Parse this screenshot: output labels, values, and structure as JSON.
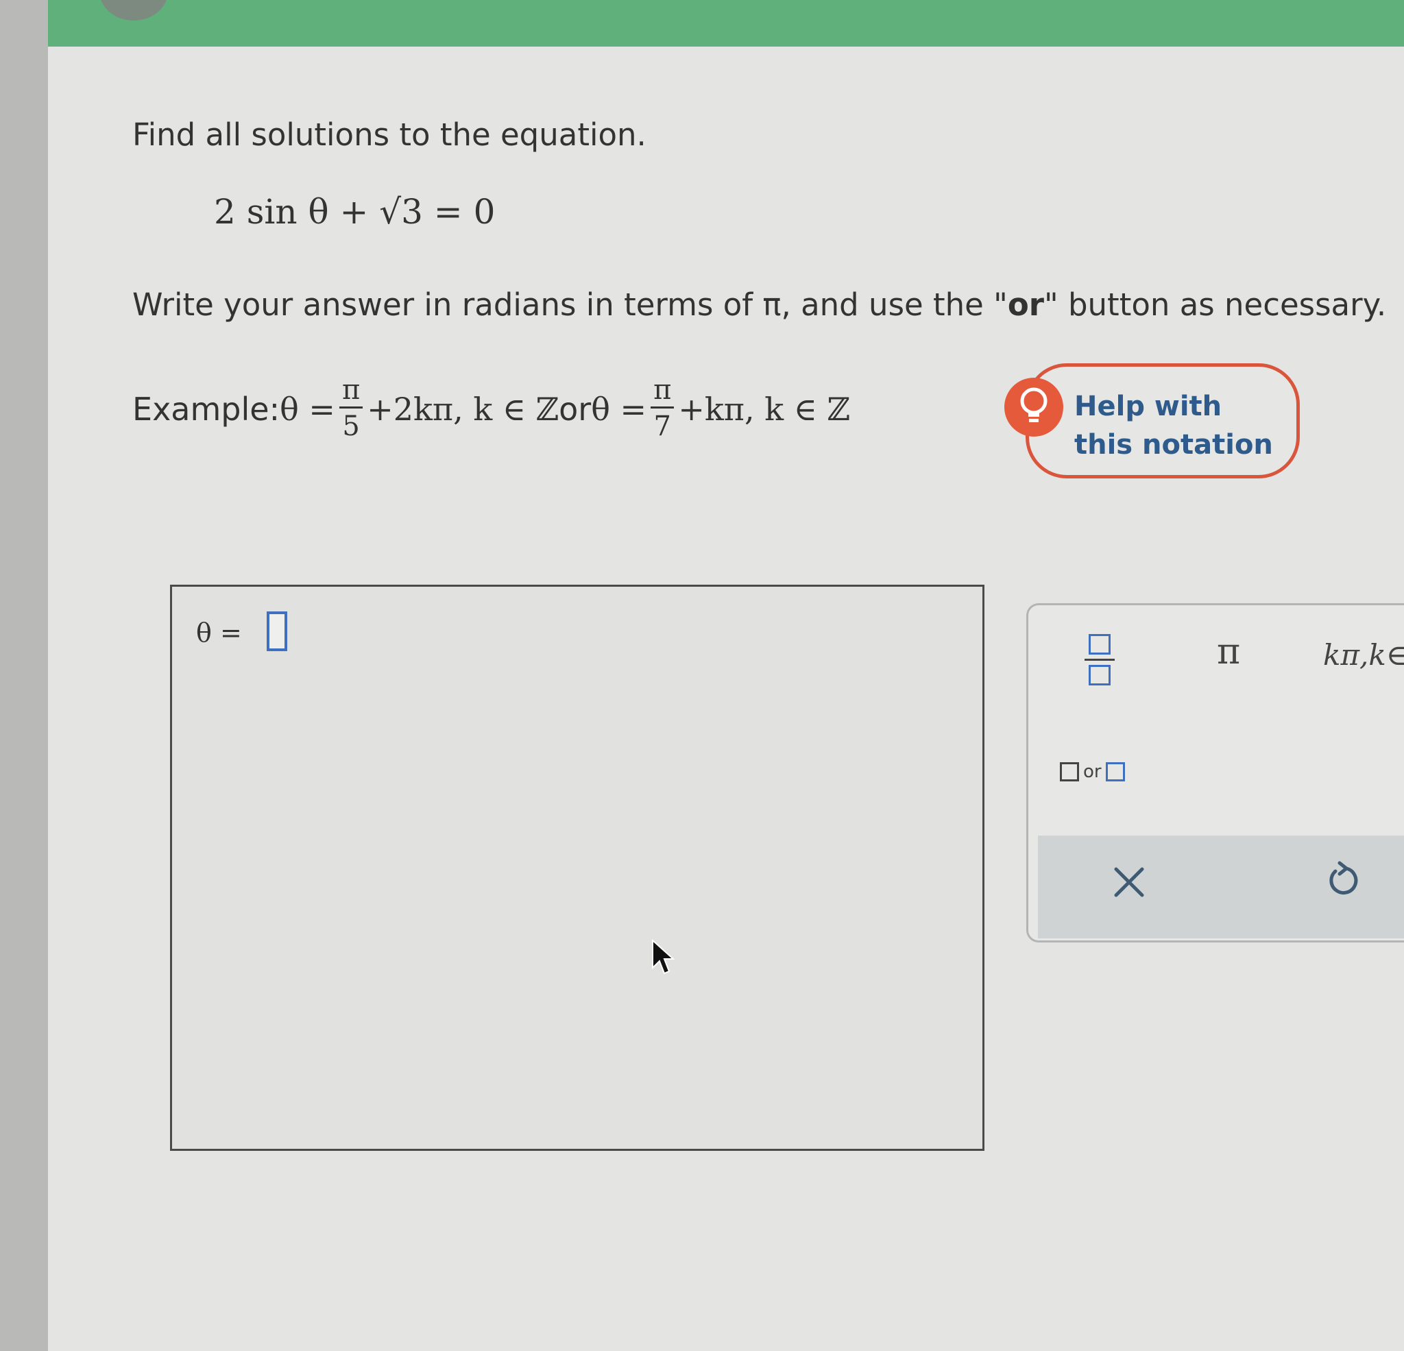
{
  "prompt": "Find all solutions to the equation.",
  "equation": "2 sin θ + √3 = 0",
  "instruction": {
    "before": "Write your answer in radians in terms of π, and use the \"",
    "bold": "or",
    "after": "\" button as necessary."
  },
  "example": {
    "label": "Example: ",
    "lhs1": "θ =",
    "frac1_num": "π",
    "frac1_den": "5",
    "rest1": "+2kπ, k ∈ ℤ",
    "or": " or ",
    "lhs2": "θ =",
    "frac2_num": "π",
    "frac2_den": "7",
    "rest2": "+kπ, k ∈ ℤ"
  },
  "help": {
    "line1": "Help with",
    "line2": "this notation"
  },
  "answer": {
    "lhs": "θ =",
    "value": ""
  },
  "palette": {
    "pi": "π",
    "kpi": "kπ,k∈ℤ",
    "or_label": "or"
  },
  "colors": {
    "header": "#5fb07b",
    "accent_blue": "#3f6fbf",
    "help_red": "#d9553c",
    "help_text": "#2e5b8c"
  },
  "icons": {
    "help": "lightbulb-icon",
    "clear": "x-icon",
    "undo": "undo-icon",
    "cursor": "mouse-pointer-icon"
  }
}
